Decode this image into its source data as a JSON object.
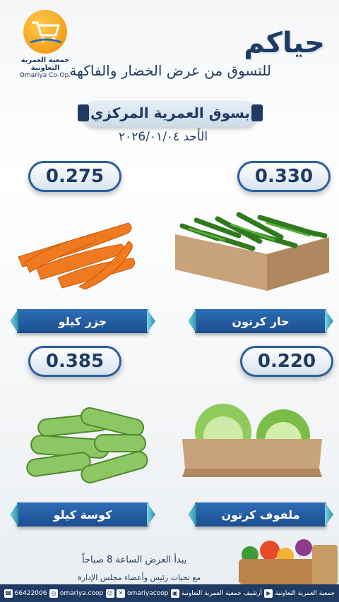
{
  "logo": {
    "name_ar": "جمعية العمرية التعاونية",
    "name_en": "Omariya Co-Op."
  },
  "header": {
    "greeting": "حياكم",
    "subtitle": "للتسوق من عرض الخضار والفاكهة",
    "market": "بسوق العمرية المركزي",
    "date": "الأحد ٢٠٢6/٠١/٠٤"
  },
  "products": [
    {
      "name": "حار كرتون",
      "price": "0.330",
      "icon": "green-chili-box-image"
    },
    {
      "name": "جزر كيلو",
      "price": "0.275",
      "icon": "carrots-image"
    },
    {
      "name": "ملفوف كرتون",
      "price": "0.220",
      "icon": "cabbage-box-image"
    },
    {
      "name": "كوسة كيلو",
      "price": "0.385",
      "icon": "zucchini-image"
    }
  ],
  "footer": {
    "start_time": "يبدأ العرض الساعة 8 صباحاً",
    "greetings": "مع تحيات رئيس وأعضاء مجلس الإدارة",
    "contacts": [
      {
        "icon": "phone-icon",
        "text": "66422006"
      },
      {
        "icon": "instagram-icon",
        "text": "omariya.coop"
      },
      {
        "icon": "snapchat-icon",
        "text": ""
      },
      {
        "icon": "x-icon",
        "text": "omariyacoop"
      },
      {
        "icon": "website-icon",
        "text": "أرشيف جمعية العمرية التعاونية"
      },
      {
        "icon": "youtube-icon",
        "text": "جمعية العمرية التعاونية"
      }
    ]
  },
  "colors": {
    "primary": "#1f3b63",
    "banner": "#2d6db5",
    "accent": "#f5a623"
  }
}
